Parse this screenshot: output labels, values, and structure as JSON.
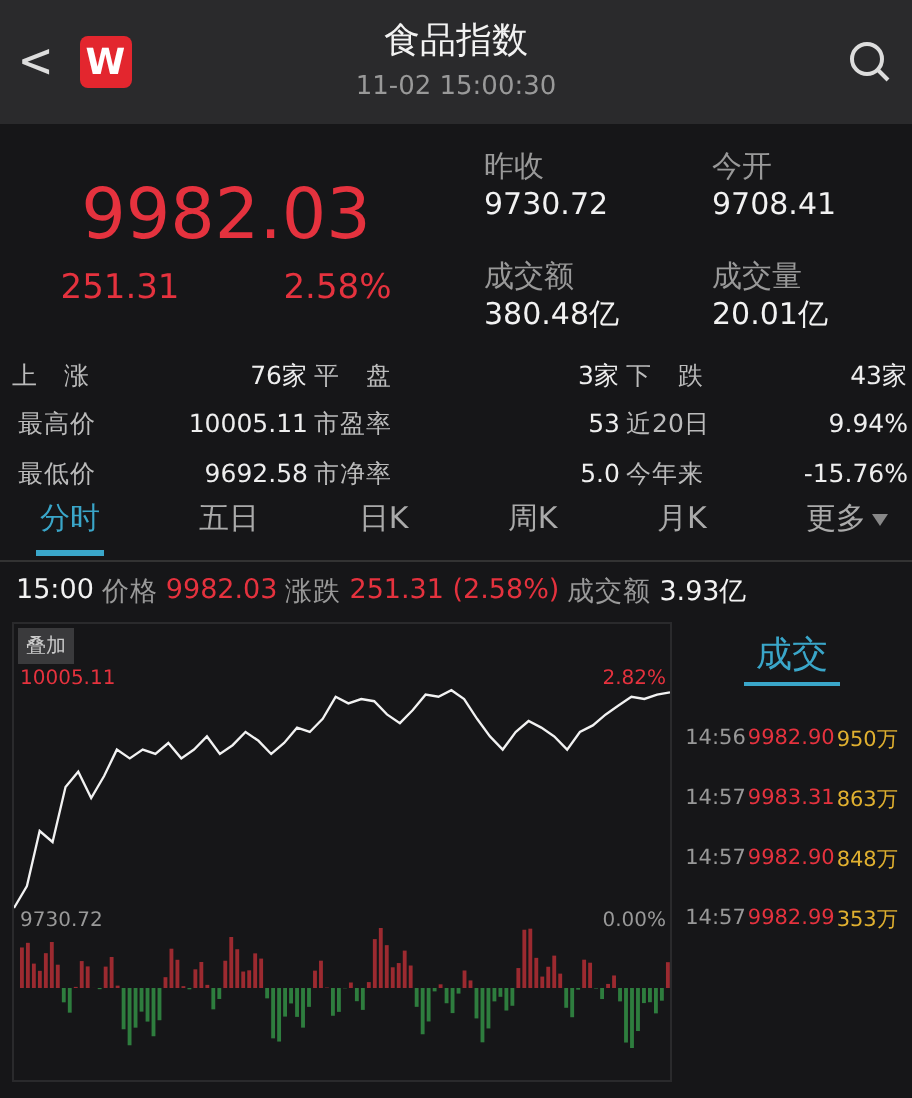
{
  "header": {
    "back": "<",
    "logo": "W",
    "title": "食品指数",
    "time": "11-02 15:00:30"
  },
  "quote": {
    "price": "9982.03",
    "change": "251.31",
    "percent": "2.58%"
  },
  "stats": [
    {
      "label": "昨收",
      "value": "9730.72"
    },
    {
      "label": "今开",
      "value": "9708.41"
    },
    {
      "label": "成交额",
      "value": "380.48亿"
    },
    {
      "label": "成交量",
      "value": "20.01亿"
    }
  ],
  "details": [
    {
      "label": "上　涨",
      "value": "76家"
    },
    {
      "label": "平　盘",
      "value": "3家"
    },
    {
      "label": "下　跌",
      "value": "43家"
    },
    {
      "label": "最高价",
      "value": "10005.11"
    },
    {
      "label": "市盈率",
      "value": "53"
    },
    {
      "label": "近20日",
      "value": "9.94%"
    },
    {
      "label": "最低价",
      "value": "9692.58"
    },
    {
      "label": "市净率",
      "value": "5.0"
    },
    {
      "label": "今年来",
      "value": "-15.76%"
    }
  ],
  "tabs": [
    {
      "label": "分时",
      "selected": true
    },
    {
      "label": "五日",
      "selected": false
    },
    {
      "label": "日K",
      "selected": false
    },
    {
      "label": "周K",
      "selected": false
    },
    {
      "label": "月K",
      "selected": false
    },
    {
      "label": "更多",
      "selected": false,
      "dropdown": true
    }
  ],
  "info": {
    "time": "15:00",
    "price_label": "价格",
    "price": "9982.03",
    "change_label": "涨跌",
    "change": "251.31 (2.58%)",
    "amount_label": "成交额",
    "amount": "3.93亿"
  },
  "chart": {
    "overlay_button": "叠加",
    "high": "10005.11",
    "high_pct": "2.82%",
    "base": "9730.72",
    "base_pct": "0.00%"
  },
  "trades": {
    "title": "成交",
    "rows": [
      {
        "time": "14:56",
        "price": "9982.90",
        "volume": "950万"
      },
      {
        "time": "14:57",
        "price": "9983.31",
        "volume": "863万"
      },
      {
        "time": "14:57",
        "price": "9982.90",
        "volume": "848万"
      },
      {
        "time": "14:57",
        "price": "9982.99",
        "volume": "353万"
      }
    ]
  }
}
